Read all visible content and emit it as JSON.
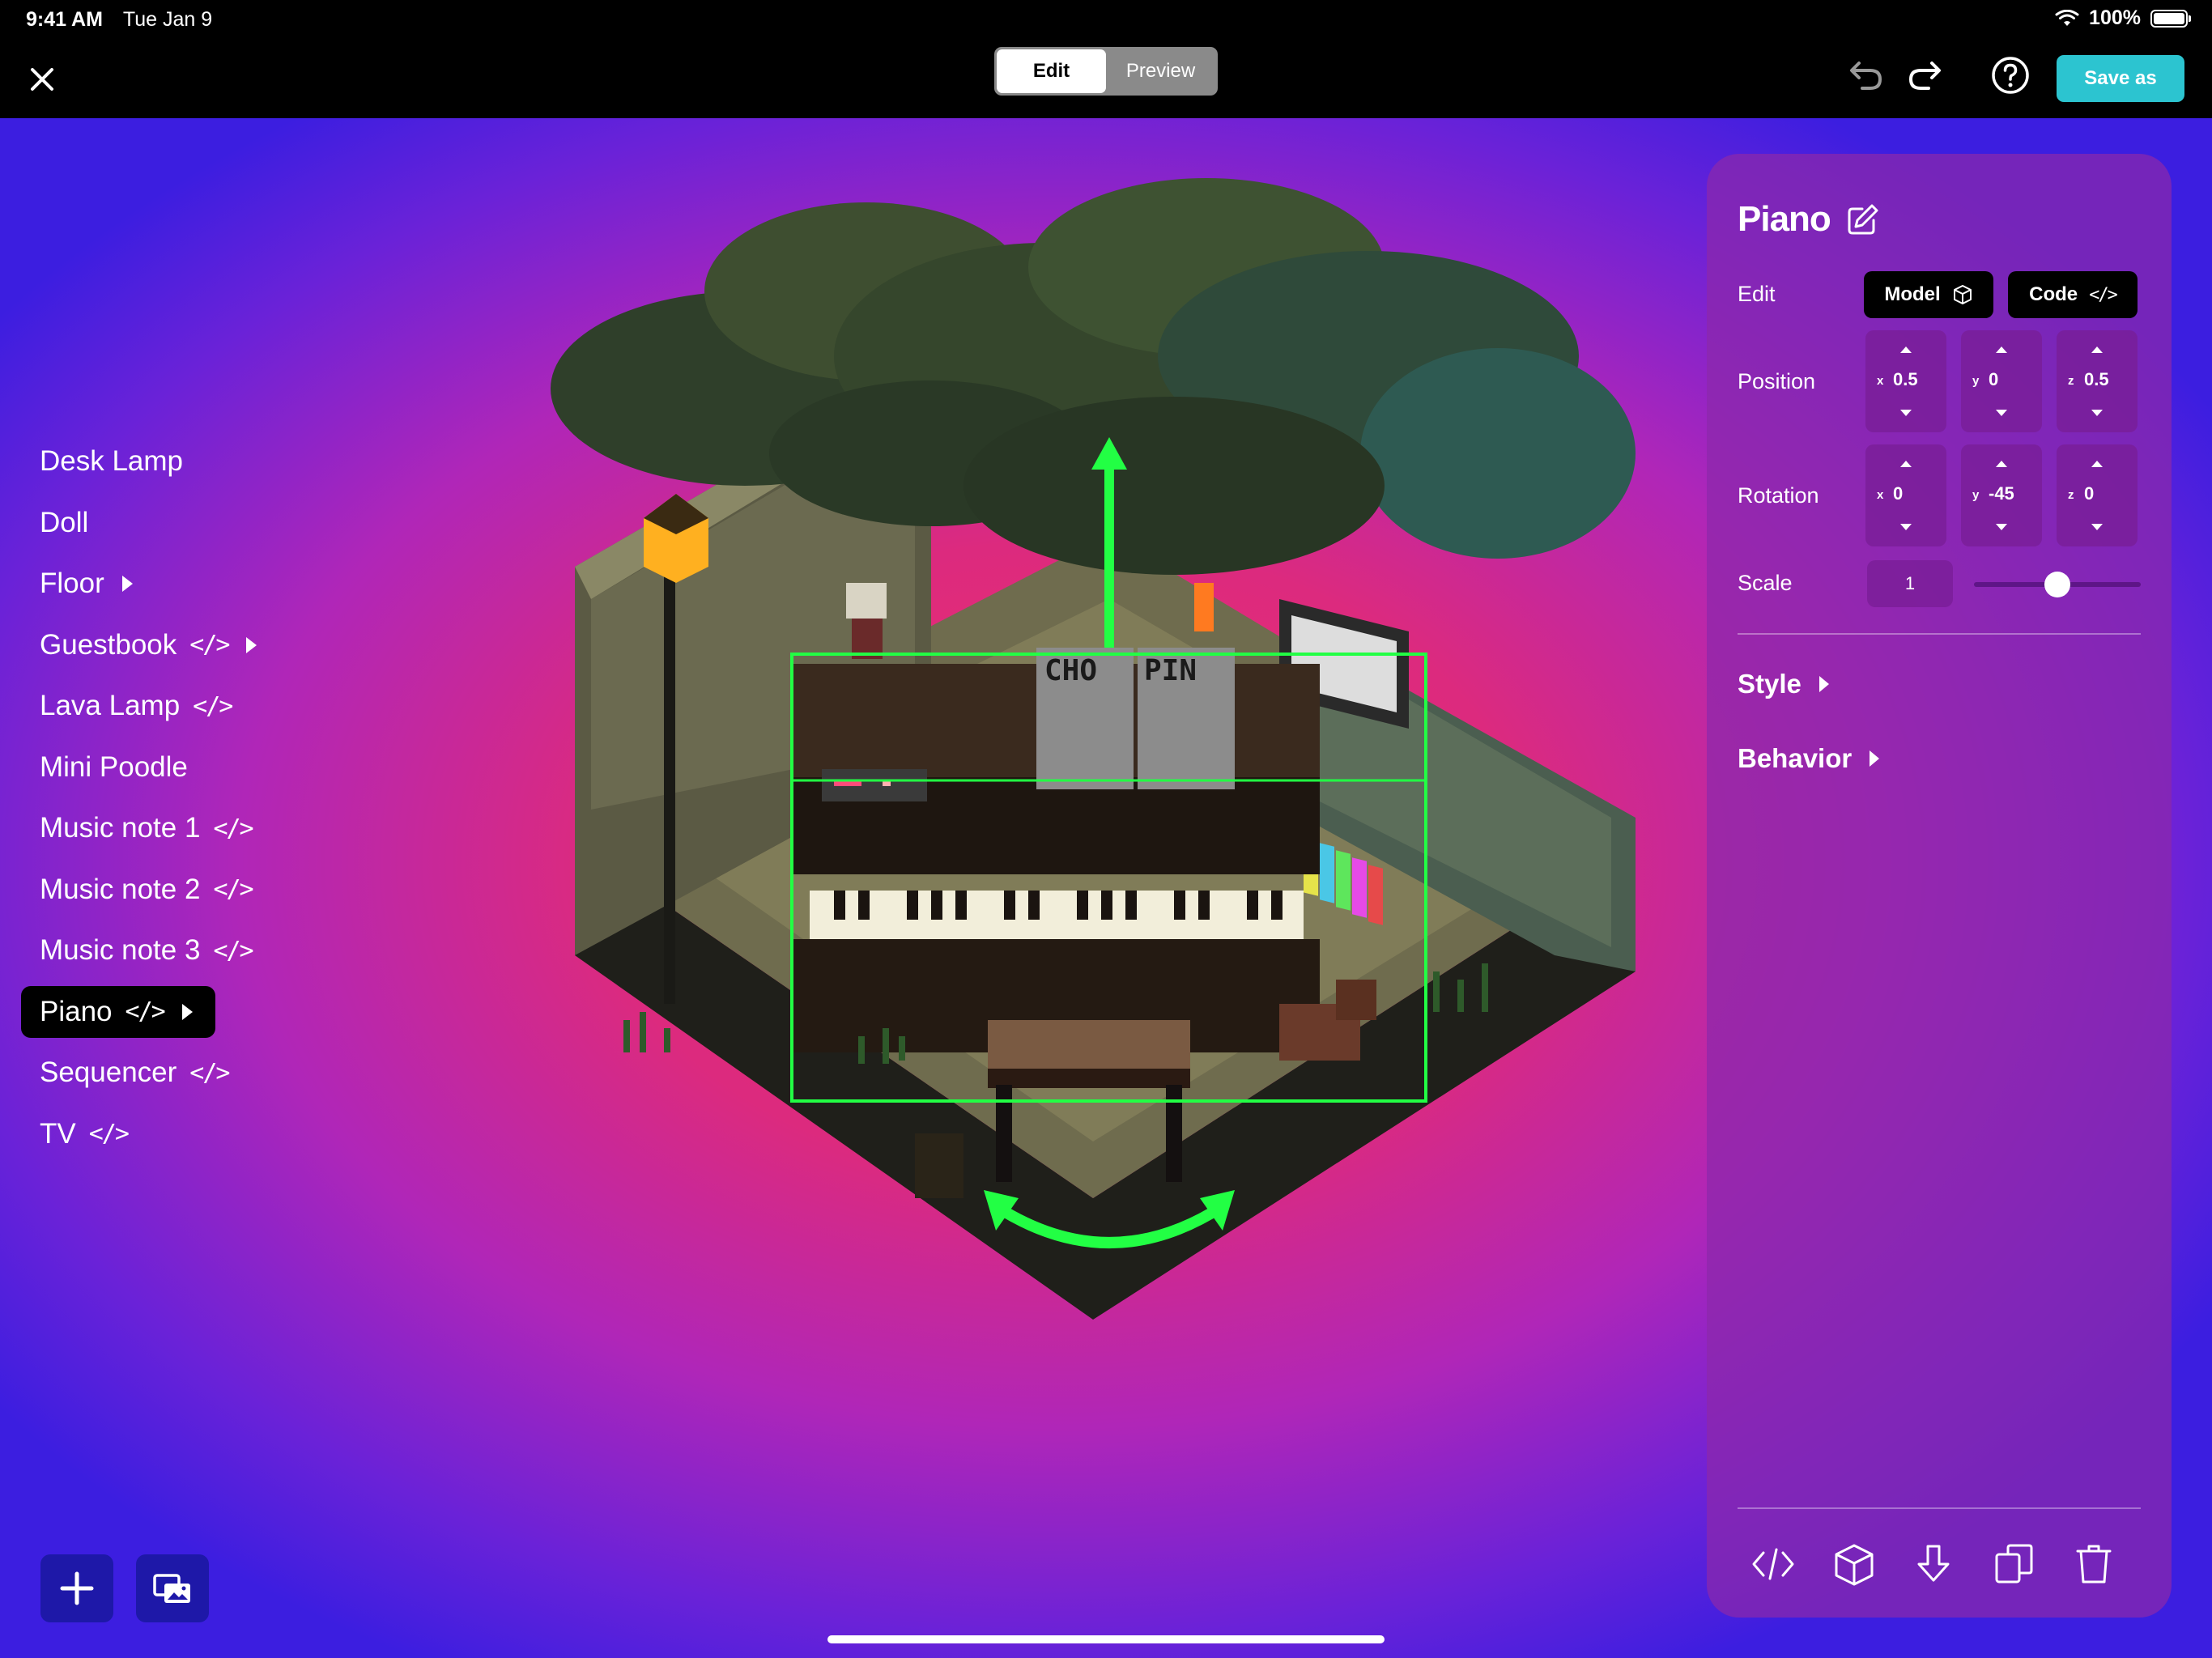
{
  "status_bar": {
    "time": "9:41 AM",
    "date": "Tue Jan 9",
    "battery": "100%"
  },
  "toolbar": {
    "mode_tabs": [
      {
        "label": "Edit",
        "active": true
      },
      {
        "label": "Preview",
        "active": false
      }
    ],
    "save_label": "Save as",
    "icons": [
      "close-icon",
      "undo-icon",
      "redo-icon",
      "help-icon"
    ]
  },
  "objects": [
    {
      "label": "Desk Lamp",
      "code": false,
      "expand": false
    },
    {
      "label": "Doll",
      "code": false,
      "expand": false
    },
    {
      "label": "Floor",
      "code": false,
      "expand": true
    },
    {
      "label": "Guestbook",
      "code": true,
      "expand": true
    },
    {
      "label": "Lava Lamp",
      "code": true,
      "expand": false
    },
    {
      "label": "Mini Poodle",
      "code": false,
      "expand": false
    },
    {
      "label": "Music note 1",
      "code": true,
      "expand": false
    },
    {
      "label": "Music note 2",
      "code": true,
      "expand": false
    },
    {
      "label": "Music note 3",
      "code": true,
      "expand": false
    },
    {
      "label": "Piano",
      "code": true,
      "expand": true,
      "selected": true
    },
    {
      "label": "Sequencer",
      "code": true,
      "expand": false
    },
    {
      "label": "TV",
      "code": true,
      "expand": false
    }
  ],
  "code_glyph": "</>",
  "scene": {
    "sheet_music_left": "CHO",
    "sheet_music_right": "PIN"
  },
  "inspector": {
    "title": "Piano",
    "edit_label": "Edit",
    "model_label": "Model",
    "code_label": "Code",
    "position_label": "Position",
    "position": {
      "x": "0.5",
      "y": "0",
      "z": "0.5"
    },
    "rotation_label": "Rotation",
    "rotation": {
      "x": "0",
      "y": "-45",
      "z": "0"
    },
    "scale_label": "Scale",
    "scale": "1",
    "scale_slider_fraction": 0.5,
    "style_label": "Style",
    "behavior_label": "Behavior",
    "axis_labels": {
      "x": "x",
      "y": "y",
      "z": "z"
    },
    "bottom_icons": [
      "code-icon",
      "cube-icon",
      "download-icon",
      "duplicate-icon",
      "trash-icon"
    ]
  },
  "colors": {
    "accent": "#2cc4d0",
    "selection_green": "#22ff44",
    "panel": "#8c28aa"
  }
}
